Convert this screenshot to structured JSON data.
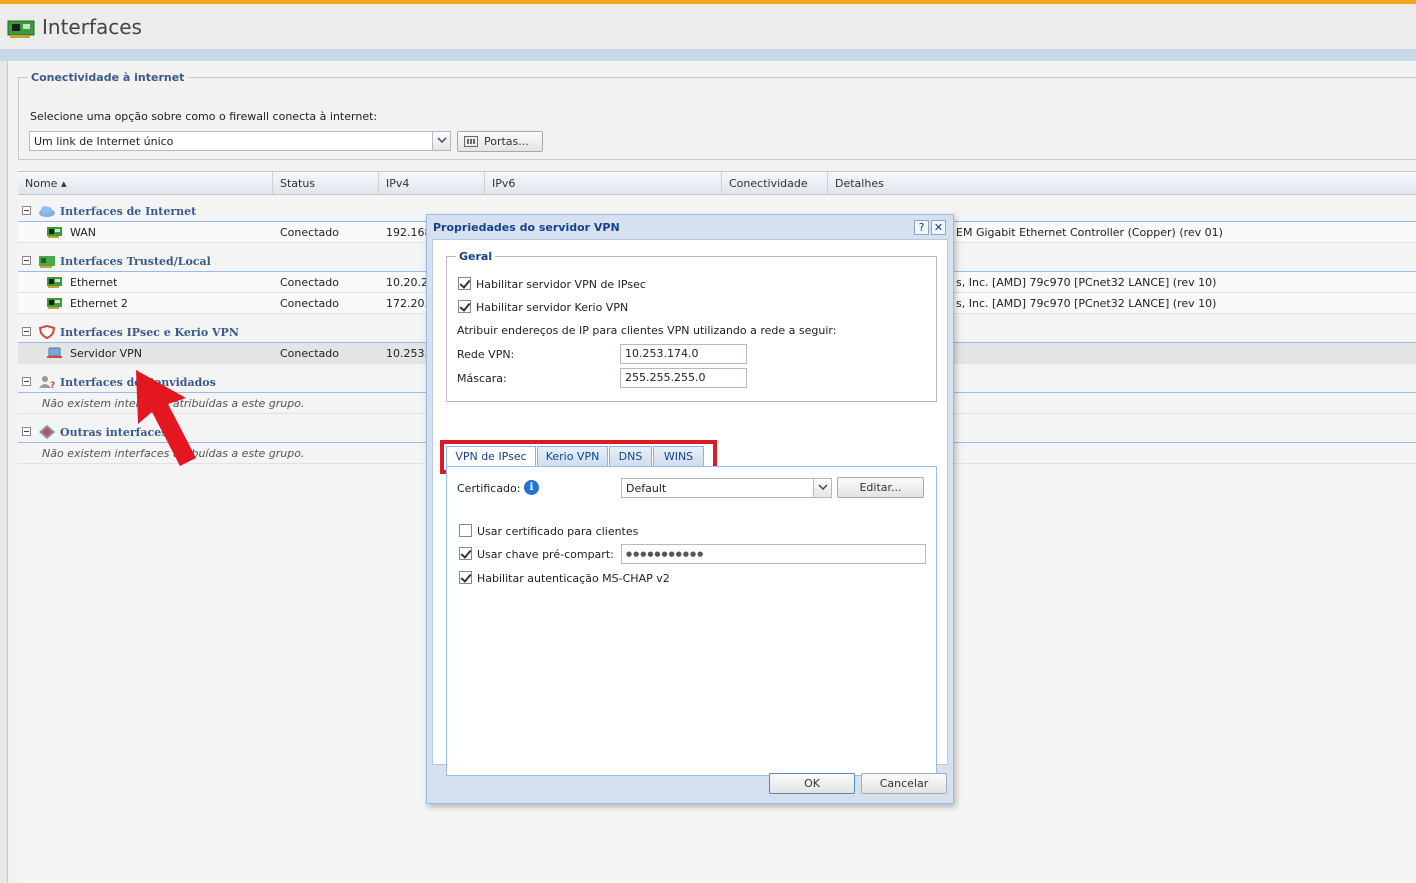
{
  "app": {
    "title": "Interfaces"
  },
  "connectivity": {
    "legend": "Conectividade à internet",
    "prompt": "Selecione uma opção sobre como o firewall conecta à internet:",
    "mode_value": "Um link de Internet único",
    "ports_button": "Portas..."
  },
  "grid": {
    "columns": {
      "name": "Nome ▴",
      "status": "Status",
      "ipv4": "IPv4",
      "ipv6": "IPv6",
      "connectivity": "Conectividade",
      "details": "Detalhes"
    },
    "groups": {
      "internet": {
        "label": "Interfaces de Internet",
        "rows": [
          {
            "name": "WAN",
            "status": "Conectado",
            "ipv4": "192.168",
            "details": "EM Gigabit Ethernet Controller (Copper) (rev 01)"
          }
        ]
      },
      "trusted": {
        "label": "Interfaces Trusted/Local",
        "rows": [
          {
            "name": "Ethernet",
            "status": "Conectado",
            "ipv4": "10.20.20",
            "details": "s, Inc. [AMD] 79c970 [PCnet32 LANCE] (rev 10)"
          },
          {
            "name": "Ethernet 2",
            "status": "Conectado",
            "ipv4": "172.20.2",
            "details": "s, Inc. [AMD] 79c970 [PCnet32 LANCE] (rev 10)"
          }
        ]
      },
      "vpn": {
        "label": "Interfaces IPsec e Kerio VPN",
        "rows": [
          {
            "name": "Servidor VPN",
            "status": "Conectado",
            "ipv4": "10.253.1"
          }
        ]
      },
      "guest": {
        "label": "Interfaces de Convidados",
        "empty": "Não existem interfaces atribuídas a este grupo."
      },
      "other": {
        "label": "Outras interfaces",
        "empty": "Não existem interfaces atribuídas a este grupo."
      }
    }
  },
  "dialog": {
    "title": "Propriedades do servidor VPN",
    "help_button": "?",
    "close_button": "✕",
    "general": {
      "legend": "Geral",
      "enable_ipsec": "Habilitar servidor VPN de IPsec",
      "enable_ipsec_checked": true,
      "enable_kerio": "Habilitar servidor Kerio VPN",
      "enable_kerio_checked": true,
      "assign_text": "Atribuir endereços de IP para clientes VPN utilizando a rede a seguir:",
      "network_label": "Rede VPN:",
      "network_value": "10.253.174.0",
      "mask_label": "Máscara:",
      "mask_value": "255.255.255.0"
    },
    "tabs": [
      "VPN de IPsec",
      "Kerio VPN",
      "DNS",
      "WINS"
    ],
    "active_tab": "VPN de IPsec",
    "ipsec": {
      "certificate_label": "Certificado:",
      "certificate_value": "Default",
      "edit_button": "Editar...",
      "use_client_cert": "Usar certificado para clientes",
      "use_client_cert_checked": false,
      "use_psk": "Usar chave pré-compart:",
      "use_psk_checked": true,
      "psk_value": "●●●●●●●●●●●",
      "mschap": "Habilitar autenticação MS-CHAP v2",
      "mschap_checked": true
    },
    "ok_button": "OK",
    "cancel_button": "Cancelar"
  },
  "colors": {
    "accent_bar": "#f2a71e",
    "highlight_box": "#e01a24",
    "arrow": "#e4161f",
    "group_text": "#3a5a8c"
  }
}
